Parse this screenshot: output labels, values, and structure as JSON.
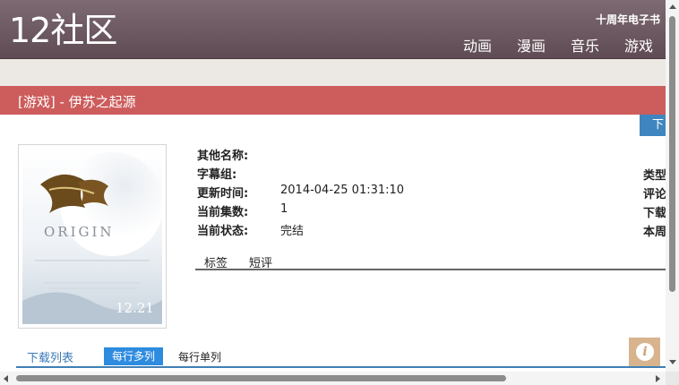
{
  "header": {
    "logo": "12社区",
    "ebook_link": "十周年电子书",
    "nav": [
      "动画",
      "漫画",
      "音乐",
      "游戏"
    ]
  },
  "title_bar": {
    "text": "[游戏] - 伊苏之起源"
  },
  "download_button": {
    "label": "下"
  },
  "cover": {
    "logo_text": "Ys",
    "subtitle": "ORIGIN",
    "date": "12.21"
  },
  "info": {
    "rows": [
      {
        "label": "其他名称:",
        "value": ""
      },
      {
        "label": "字幕组:",
        "value": ""
      },
      {
        "label": "更新时间:",
        "value": "2014-04-25 01:31:10"
      },
      {
        "label": "当前集数:",
        "value": "1"
      },
      {
        "label": "当前状态:",
        "value": "完结"
      }
    ],
    "right_labels": [
      "类型",
      "评论",
      "下载",
      "本周"
    ]
  },
  "tabs": [
    "标签",
    "短评"
  ],
  "download_list": {
    "title": "下载列表",
    "multi": "每行多列",
    "single": "每行单列"
  },
  "colors": {
    "header": "#6b575f",
    "title_bar": "#cd5c5c",
    "accent_blue": "#2d8be0"
  },
  "icons": {
    "info": "info-icon"
  }
}
